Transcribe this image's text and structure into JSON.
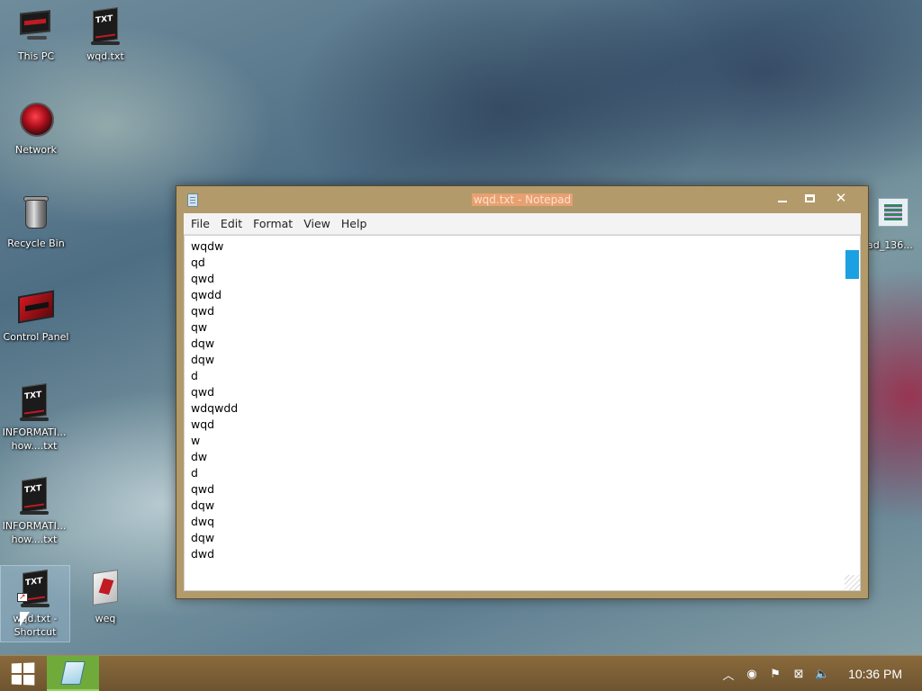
{
  "desktop": {
    "icons": [
      {
        "label": "This PC"
      },
      {
        "label": "wqd.txt"
      },
      {
        "label": "Network"
      },
      {
        "label": "Recycle Bin"
      },
      {
        "label": "Control Panel"
      },
      {
        "label": "INFORMATI... how....txt"
      },
      {
        "label": "INFORMATI... how....txt"
      },
      {
        "label": "wqd.txt - Shortcut"
      },
      {
        "label": "weq"
      },
      {
        "label": "ad_136..."
      }
    ]
  },
  "notepad": {
    "title": "wqd.txt - Notepad",
    "menu": [
      "File",
      "Edit",
      "Format",
      "View",
      "Help"
    ],
    "content": "wqdw\nqd\nqwd\nqwdd\nqwd\nqw\ndqw\ndqw\nd\nqwd\nwdqwdd\nwqd\nw\ndw\nd\nqwd\ndqw\ndwq\ndqw\ndwd"
  },
  "taskbar": {
    "clock": "10:36 PM",
    "tray_icons": [
      "chevron-up-icon",
      "antivirus-icon",
      "action-center-flag-icon",
      "network-icon",
      "volume-icon"
    ]
  },
  "colors": {
    "window_frame": "#b29a6a",
    "taskbar": "#7a5e36",
    "scroll_thumb": "#1ba1e2",
    "taskbar_active": "#6faa3a"
  }
}
